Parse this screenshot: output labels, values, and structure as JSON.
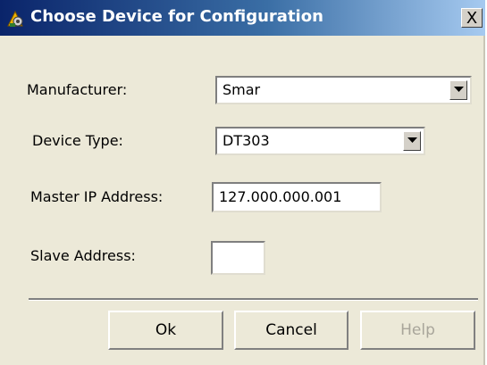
{
  "window": {
    "title": "Choose Device for Configuration",
    "close_label": "X",
    "icon": "device-config-icon"
  },
  "form": {
    "manufacturer_label": "Manufacturer:",
    "manufacturer_value": "Smar",
    "device_type_label": "Device Type:",
    "device_type_value": "DT303",
    "master_ip_label": "Master IP Address:",
    "master_ip_value": "127.000.000.001",
    "slave_address_label": "Slave Address:",
    "slave_address_value": ""
  },
  "buttons": {
    "ok": "Ok",
    "cancel": "Cancel",
    "help": "Help"
  },
  "colors": {
    "title_bar_start": "#0a246a",
    "title_bar_end": "#a6caf0",
    "dialog_background": "#ece9d8",
    "disabled_text": "#a8a59a"
  }
}
